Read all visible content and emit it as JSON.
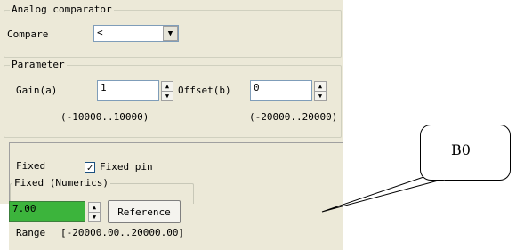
{
  "analog": {
    "title": "Analog comparator",
    "compare_label": "Compare",
    "compare_value": "<"
  },
  "parameter": {
    "title": "Parameter",
    "gain_label": "Gain(a)",
    "gain_value": "1",
    "gain_range": "(-10000..10000)",
    "offset_label": "Offset(b)",
    "offset_value": "0",
    "offset_range": "(-20000..20000)"
  },
  "fixed": {
    "label": "Fixed",
    "checkbox_label": "Fixed pin",
    "checked": true,
    "group_title": "Fixed (Numerics)",
    "value": "7.00",
    "value_bg": "#3cb43c",
    "reference_label": "Reference",
    "range_label": "Range",
    "range_value": "[-20000.00..20000.00]"
  },
  "callout": {
    "text": "B0"
  }
}
